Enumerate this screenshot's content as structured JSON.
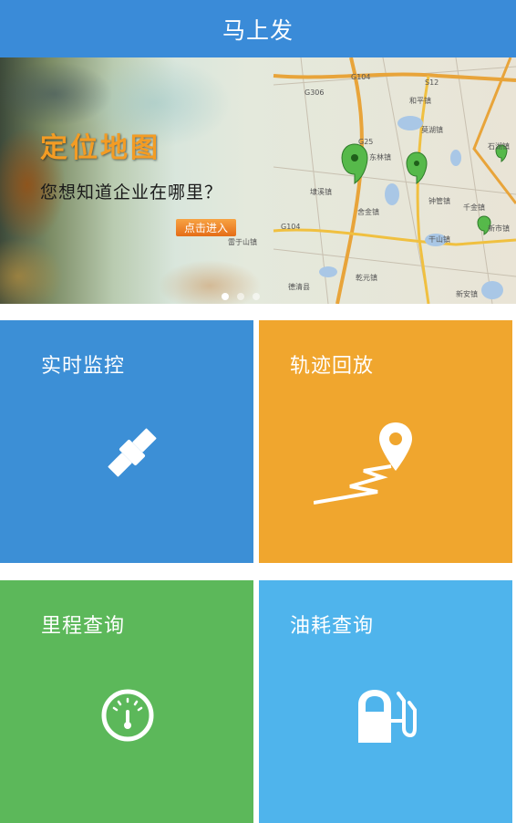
{
  "header": {
    "title": "马上发"
  },
  "banner": {
    "title": "定位地图",
    "subtitle": "您想知道企业在哪里？",
    "cta_label": "点击进入",
    "map_labels": [
      "G104",
      "S12",
      "G306",
      "和平镇",
      "G25",
      "莫湖镇",
      "石湖镇",
      "东林镇",
      "千金镇",
      "埭溪镇",
      "钟管镇",
      "舍金镇",
      "G104",
      "干山镇",
      "新市镇",
      "雷于山镇",
      "乾元镇",
      "德清县",
      "新安镇"
    ],
    "slide_count": 3,
    "active_slide": 0
  },
  "tiles": [
    {
      "label": "实时监控",
      "icon": "satellite-icon",
      "color": "#3c8fd6"
    },
    {
      "label": "轨迹回放",
      "icon": "route-pin-icon",
      "color": "#f0a62e"
    },
    {
      "label": "里程查询",
      "icon": "speedometer-icon",
      "color": "#5cb85a"
    },
    {
      "label": "油耗查询",
      "icon": "fuel-pump-icon",
      "color": "#4fb4ec"
    }
  ]
}
